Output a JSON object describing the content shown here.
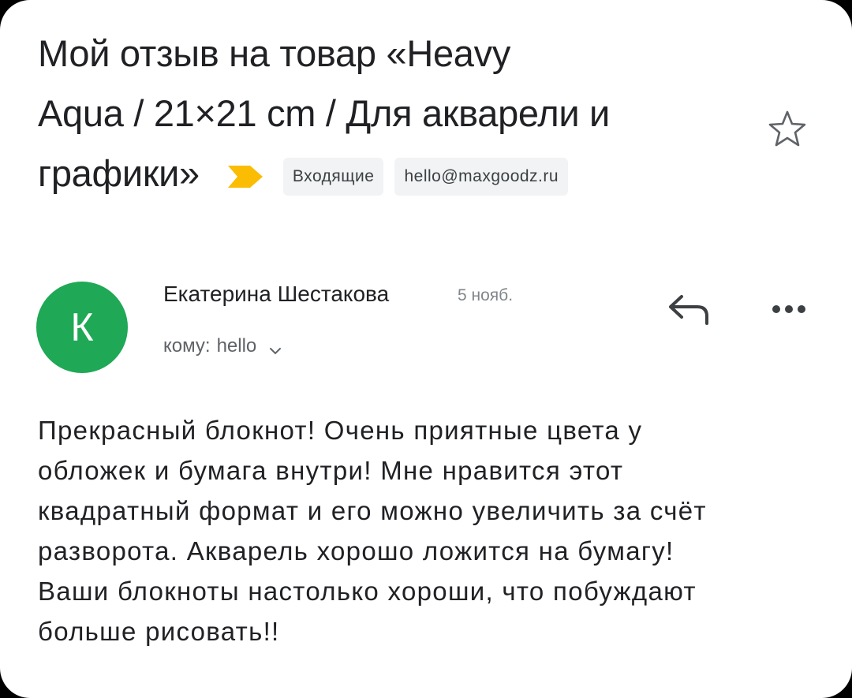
{
  "subject": {
    "lines": [
      "Мой отзыв на товар «Heavy",
      "Aqua / 21×21 cm / Для акварели и",
      "графики»"
    ]
  },
  "labels": [
    "Входящие",
    "hello@maxgoodz.ru"
  ],
  "icons": {
    "importance": "importance-marker-icon",
    "star": "star-icon",
    "reply": "reply-icon",
    "more": "more-options-icon",
    "expand": "chevron-down-icon"
  },
  "colors": {
    "avatar": "#1fa855",
    "importance": "#fbbc04",
    "label_bg": "#f1f3f4"
  },
  "message": {
    "avatar_letter": "К",
    "sender": "Екатерина Шестакова",
    "date": "5 нояб.",
    "to_label": "кому:",
    "to_value": "hello",
    "body_lines": [
      "Прекрасный блокнот! Очень приятные цвета у",
      "обложек и бумага внутри! Мне нравится этот",
      "квадратный формат и его можно увеличить за счёт",
      "разворота. Акварель хорошо ложится на бумагу!",
      "Ваши блокноты настолько хороши, что побуждают",
      "больше рисовать!!"
    ]
  }
}
